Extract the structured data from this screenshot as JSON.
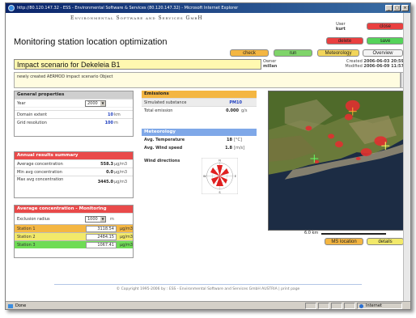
{
  "window": {
    "title": "http://80.120.147.32 - ESS - Environmental Software & Services (80.120.147.32) - Microsoft Internet Explorer",
    "controls": [
      "_",
      "□",
      "×"
    ]
  },
  "header": {
    "company": "Environmental Software and Services GmbH",
    "app_title": "Monitoring station location optimization",
    "user_label": "User",
    "user_name": "kurt"
  },
  "buttons": {
    "close": "close",
    "delete": "delete",
    "save": "save",
    "check": "check",
    "run": "run",
    "meteorology": "Meteorology",
    "overview": "Overview",
    "ms_location": "MS location",
    "details": "details"
  },
  "scenario": {
    "title": "Impact scenario for Dekeleia B1",
    "owner_label": "Owner",
    "owner": "millan",
    "created_label": "Created",
    "created": "2006-06-03 20:59",
    "modified_label": "Modified",
    "modified": "2006-06-09 11:57",
    "description": "newly created AERMOD impact scenario Object"
  },
  "general": {
    "header": "General properties",
    "year_label": "Year",
    "year_value": "2000",
    "extent_label": "Domain extent",
    "extent_value": "10",
    "extent_unit": "km",
    "grid_label": "Grid resolution",
    "grid_value": "100",
    "grid_unit": "m"
  },
  "annual": {
    "header": "Annual results summary",
    "rows": [
      {
        "label": "Average concentration",
        "value": "558.3",
        "unit": "µg/m3"
      },
      {
        "label": "Min avg concentration",
        "value": "0.0",
        "unit": "µg/m3"
      },
      {
        "label": "Max avg concentration",
        "value": "3445.0",
        "unit": "µg/m3"
      }
    ]
  },
  "monitoring": {
    "header": "Average concentration - Monitoring",
    "exclusion_label": "Exclusion radius",
    "exclusion_value": "1000",
    "exclusion_unit": "m",
    "stations": [
      {
        "label": "Station 1",
        "value": "3118.54",
        "unit": "µg/m3",
        "color": "#f4b642"
      },
      {
        "label": "Station 2",
        "value": "2484.15",
        "unit": "µg/m3",
        "color": "#f2e96a"
      },
      {
        "label": "Station 3",
        "value": "1067.41",
        "unit": "µg/m3",
        "color": "#6fdc55"
      }
    ]
  },
  "emissions": {
    "header": "Emissions",
    "substance_label": "Simulated substance",
    "substance_value": "PM10",
    "total_label": "Total emission",
    "total_value": "0.000",
    "total_unit": "g/s"
  },
  "meteo": {
    "header": "Meteorology",
    "temp_label": "Avg. Temperature",
    "temp_value": "18",
    "temp_unit": "[°C]",
    "wind_label": "Avg. Wind speed",
    "wind_value": "1.8",
    "wind_unit": "[m/s]",
    "dir_label": "Wind directions",
    "compass": {
      "n": "N",
      "e": "E",
      "s": "S",
      "w": "W"
    }
  },
  "map": {
    "scale_label": "6.0 km"
  },
  "footer": {
    "copyright": "© Copyright 1995-2006 by : ESS - Environmental Software and Services GmbH AUSTRIA | print page"
  },
  "statusbar": {
    "status": "Done",
    "zone": "Internet"
  },
  "colors": {
    "red": "#e94a4a",
    "orange": "#f4b642",
    "green": "#55d35a",
    "yellow": "#fff8b0",
    "blue": "#7fa8e8"
  }
}
